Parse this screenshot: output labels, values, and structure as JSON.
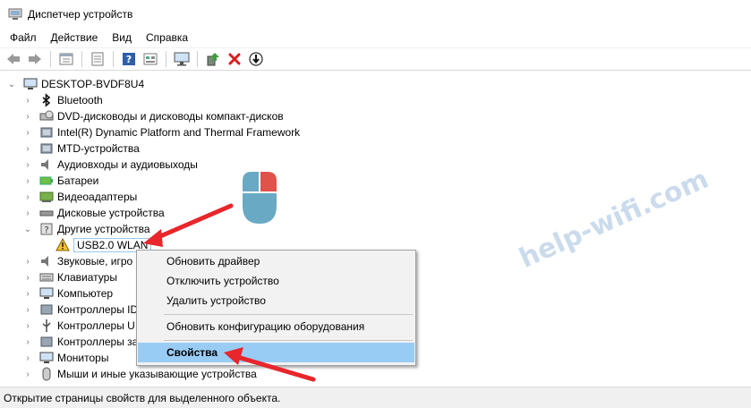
{
  "window": {
    "title": "Диспетчер устройств"
  },
  "menu": [
    "Файл",
    "Действие",
    "Вид",
    "Справка"
  ],
  "toolbar": {
    "icons": [
      "back-icon",
      "forward-icon",
      "properties-icon",
      "list-icon",
      "help-icon",
      "view-icon",
      "monitor-icon",
      "update-driver-icon",
      "uninstall-icon",
      "download-icon"
    ]
  },
  "tree": {
    "root": "DESKTOP-BVDF8U4",
    "items": [
      {
        "label": "Bluetooth",
        "icon": "bluetooth-icon"
      },
      {
        "label": "DVD-дисководы и дисководы компакт-дисков",
        "icon": "dvd-icon"
      },
      {
        "label": "Intel(R) Dynamic Platform and Thermal Framework",
        "icon": "chip-icon"
      },
      {
        "label": "MTD-устройства",
        "icon": "chip-icon"
      },
      {
        "label": "Аудиовходы и аудиовыходы",
        "icon": "speaker-icon"
      },
      {
        "label": "Батареи",
        "icon": "battery-icon"
      },
      {
        "label": "Видеоадаптеры",
        "icon": "display-adapter-icon"
      },
      {
        "label": "Дисковые устройства",
        "icon": "disk-icon"
      },
      {
        "label": "Другие устройства",
        "icon": "unknown-device-icon"
      },
      {
        "label": "USB2.0 WLAN",
        "icon": "warning-device-icon"
      },
      {
        "label": "Звуковые, игро",
        "icon": "sound-icon"
      },
      {
        "label": "Клавиатуры",
        "icon": "keyboard-icon"
      },
      {
        "label": "Компьютер",
        "icon": "computer-icon"
      },
      {
        "label": "Контроллеры ID",
        "icon": "controller-icon"
      },
      {
        "label": "Контроллеры U",
        "icon": "usb-icon"
      },
      {
        "label": "Контроллеры за",
        "icon": "storage-icon"
      },
      {
        "label": "Мониторы",
        "icon": "monitor-icon"
      },
      {
        "label": "Мыши и иные указывающие устройства",
        "icon": "mouse-icon"
      }
    ]
  },
  "context_menu": {
    "items": [
      "Обновить драйвер",
      "Отключить устройство",
      "Удалить устройство",
      "Обновить конфигурацию оборудования",
      "Свойства"
    ]
  },
  "status": "Открытие страницы свойств для выделенного объекта.",
  "watermark": "help-wifi.com",
  "colors": {
    "highlight": "#99ccf5",
    "arrow": "#e8262b",
    "selection_border": "#99c9ef"
  }
}
